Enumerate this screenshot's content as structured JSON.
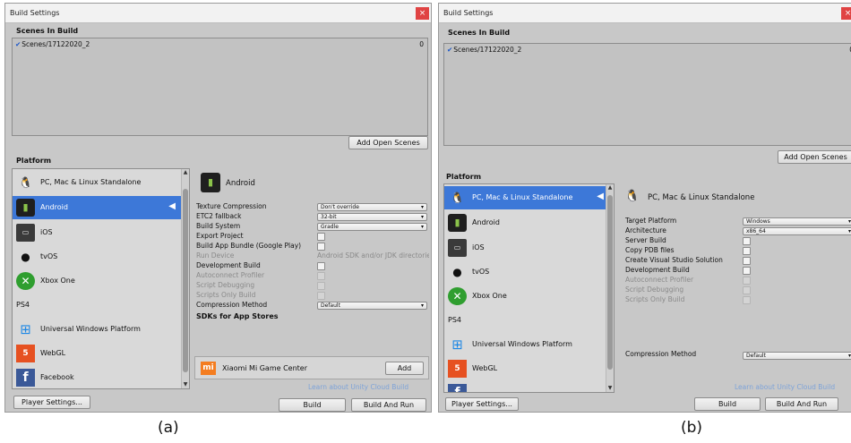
{
  "panels": [
    {
      "title": "Build Settings",
      "close": "×",
      "scenes_header": "Scenes In Build",
      "scene": {
        "name": "Scenes/17122020_2",
        "index": "0"
      },
      "add_open_scenes": "Add Open Scenes",
      "platform_header": "Platform",
      "platforms": [
        {
          "label": "PC, Mac & Linux Standalone",
          "icon": "pc-icon"
        },
        {
          "label": "Android",
          "icon": "android-icon",
          "selected": true
        },
        {
          "label": "iOS",
          "icon": "ios-icon"
        },
        {
          "label": "tvOS",
          "icon": "tvos-icon"
        },
        {
          "label": "Xbox One",
          "icon": "xbox-icon"
        },
        {
          "label": "PS4",
          "icon": "ps4-icon"
        },
        {
          "label": "Universal Windows Platform",
          "icon": "windows-icon"
        },
        {
          "label": "WebGL",
          "icon": "html5-icon"
        },
        {
          "label": "Facebook",
          "icon": "facebook-icon"
        }
      ],
      "detail_title": "Android",
      "settings": [
        {
          "label": "Texture Compression",
          "value": "Don't override"
        },
        {
          "label": "ETC2 fallback",
          "value": "32-bit"
        },
        {
          "label": "Build System",
          "value": "Gradle"
        },
        {
          "label": "Export Project"
        },
        {
          "label": "Build App Bundle (Google Play)"
        },
        {
          "label": "Run Device",
          "value": "Android SDK and/or JDK directories"
        },
        {
          "label": "Development Build"
        },
        {
          "label": "Autoconnect Profiler"
        },
        {
          "label": "Script Debugging"
        },
        {
          "label": "Scripts Only Build"
        },
        {
          "label": "Compression Method",
          "value": "Default"
        }
      ],
      "sdk_header": "SDKs for App Stores",
      "sdk_item": "Xiaomi Mi Game Center",
      "sdk_add": "Add",
      "cloud_link": "Learn about Unity Cloud Build",
      "player_settings": "Player Settings...",
      "build": "Build",
      "build_and_run": "Build And Run",
      "caption": "(a)"
    },
    {
      "title": "Build Settings",
      "close": "×",
      "scenes_header": "Scenes In Build",
      "scene": {
        "name": "Scenes/17122020_2",
        "index": "0"
      },
      "add_open_scenes": "Add Open Scenes",
      "platform_header": "Platform",
      "platforms": [
        {
          "label": "PC, Mac & Linux Standalone",
          "icon": "pc-icon",
          "selected": true
        },
        {
          "label": "Android",
          "icon": "android-icon"
        },
        {
          "label": "iOS",
          "icon": "ios-icon"
        },
        {
          "label": "tvOS",
          "icon": "tvos-icon"
        },
        {
          "label": "Xbox One",
          "icon": "xbox-icon"
        },
        {
          "label": "PS4",
          "icon": "ps4-icon"
        },
        {
          "label": "Universal Windows Platform",
          "icon": "windows-icon"
        },
        {
          "label": "WebGL",
          "icon": "html5-icon"
        }
      ],
      "detail_title": "PC, Mac & Linux Standalone",
      "settings": [
        {
          "label": "Target Platform",
          "value": "Windows"
        },
        {
          "label": "Architecture",
          "value": "x86_64"
        },
        {
          "label": "Server Build"
        },
        {
          "label": "Copy PDB files"
        },
        {
          "label": "Create Visual Studio Solution"
        },
        {
          "label": "Development Build"
        },
        {
          "label": "Autoconnect Profiler"
        },
        {
          "label": "Script Debugging"
        },
        {
          "label": "Scripts Only Build"
        },
        {
          "label": "Compression Method",
          "value": "Default"
        }
      ],
      "cloud_link": "Learn about Unity Cloud Build",
      "player_settings": "Player Settings...",
      "build": "Build",
      "build_and_run": "Build And Run",
      "caption": "(b)"
    }
  ],
  "colors": {
    "window_bg": "#c8c8c8",
    "selection": "#3d78d8",
    "close_button": "#e04343",
    "link": "#7ea3d8"
  }
}
